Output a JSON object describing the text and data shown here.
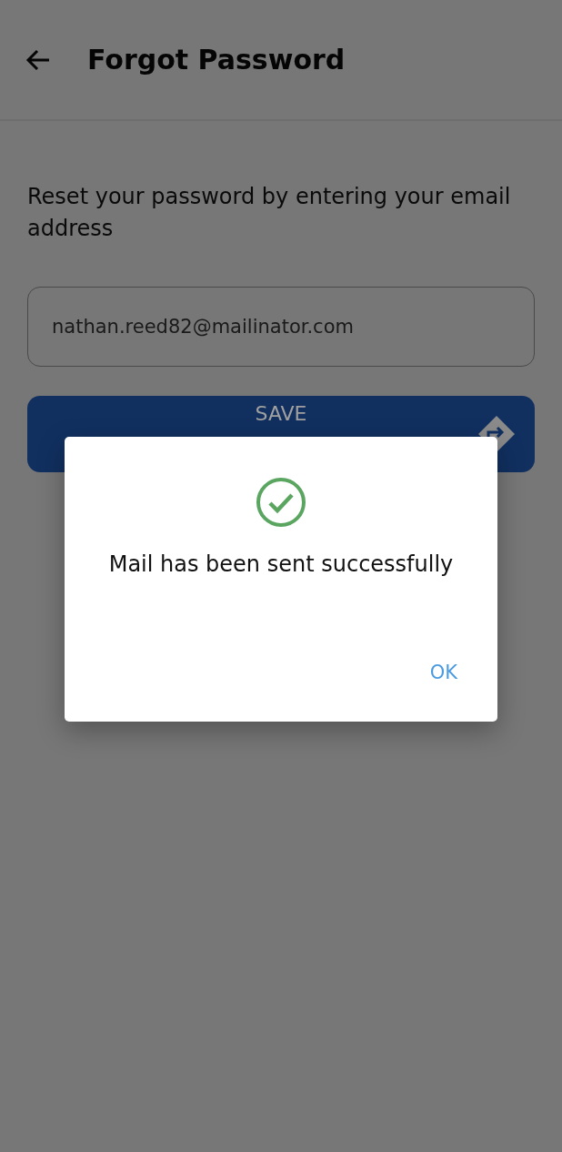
{
  "header": {
    "title": "Forgot Password"
  },
  "form": {
    "instructions": "Reset your password by entering your email address",
    "email": {
      "value": "nathan.reed82@mailinator.com"
    },
    "submit": {
      "label": "SAVE"
    }
  },
  "dialog": {
    "message": "Mail has been sent successfully",
    "buttons": [
      "OK"
    ]
  }
}
